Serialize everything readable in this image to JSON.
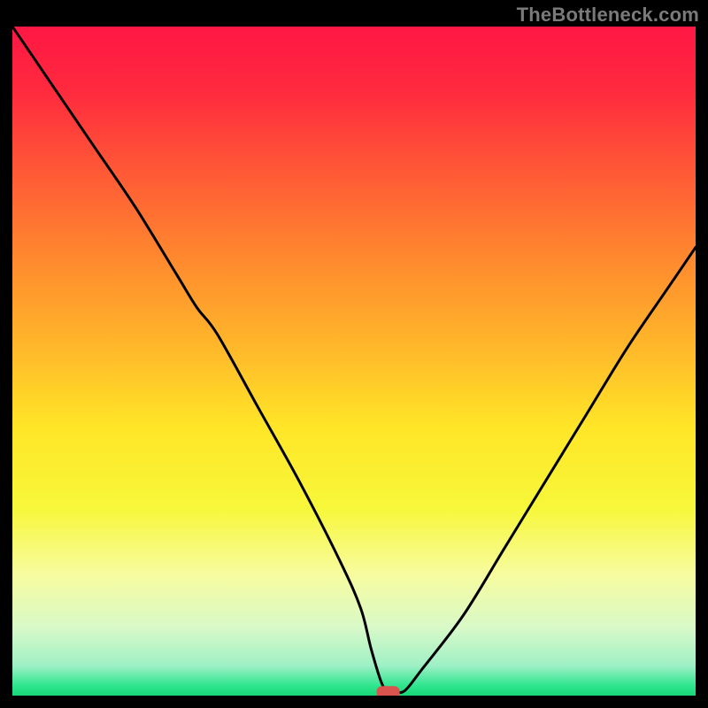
{
  "watermark": "TheBottleneck.com",
  "chart_data": {
    "type": "line",
    "title": "",
    "xlabel": "",
    "ylabel": "",
    "xlim": [
      0,
      100
    ],
    "ylim": [
      0,
      100
    ],
    "grid": false,
    "legend": false,
    "series": [
      {
        "name": "bottleneck-curve",
        "x": [
          0,
          6,
          12,
          18,
          24,
          27,
          30,
          36,
          42,
          48,
          51,
          52.5,
          54,
          55,
          56,
          57.5,
          60,
          66,
          72,
          78,
          84,
          90,
          96,
          100
        ],
        "y": [
          100,
          91,
          82,
          73,
          63,
          58,
          54,
          43,
          32,
          20,
          13,
          7,
          2,
          0.5,
          0.5,
          0.8,
          4,
          12,
          22,
          32,
          42,
          52,
          61,
          67
        ]
      }
    ],
    "marker": {
      "name": "optimal-point",
      "x": 55,
      "y": 0.5,
      "color": "#d9534f"
    },
    "gradient_stops": [
      {
        "offset": 0.0,
        "color": "#ff1744"
      },
      {
        "offset": 0.1,
        "color": "#ff2b3e"
      },
      {
        "offset": 0.22,
        "color": "#ff5a36"
      },
      {
        "offset": 0.35,
        "color": "#ff8a2e"
      },
      {
        "offset": 0.48,
        "color": "#ffb82a"
      },
      {
        "offset": 0.6,
        "color": "#ffe627"
      },
      {
        "offset": 0.72,
        "color": "#f7f73a"
      },
      {
        "offset": 0.82,
        "color": "#f7fca0"
      },
      {
        "offset": 0.9,
        "color": "#d7f9c8"
      },
      {
        "offset": 0.955,
        "color": "#9ff0c5"
      },
      {
        "offset": 0.985,
        "color": "#2fe58f"
      },
      {
        "offset": 1.0,
        "color": "#17d976"
      }
    ]
  }
}
